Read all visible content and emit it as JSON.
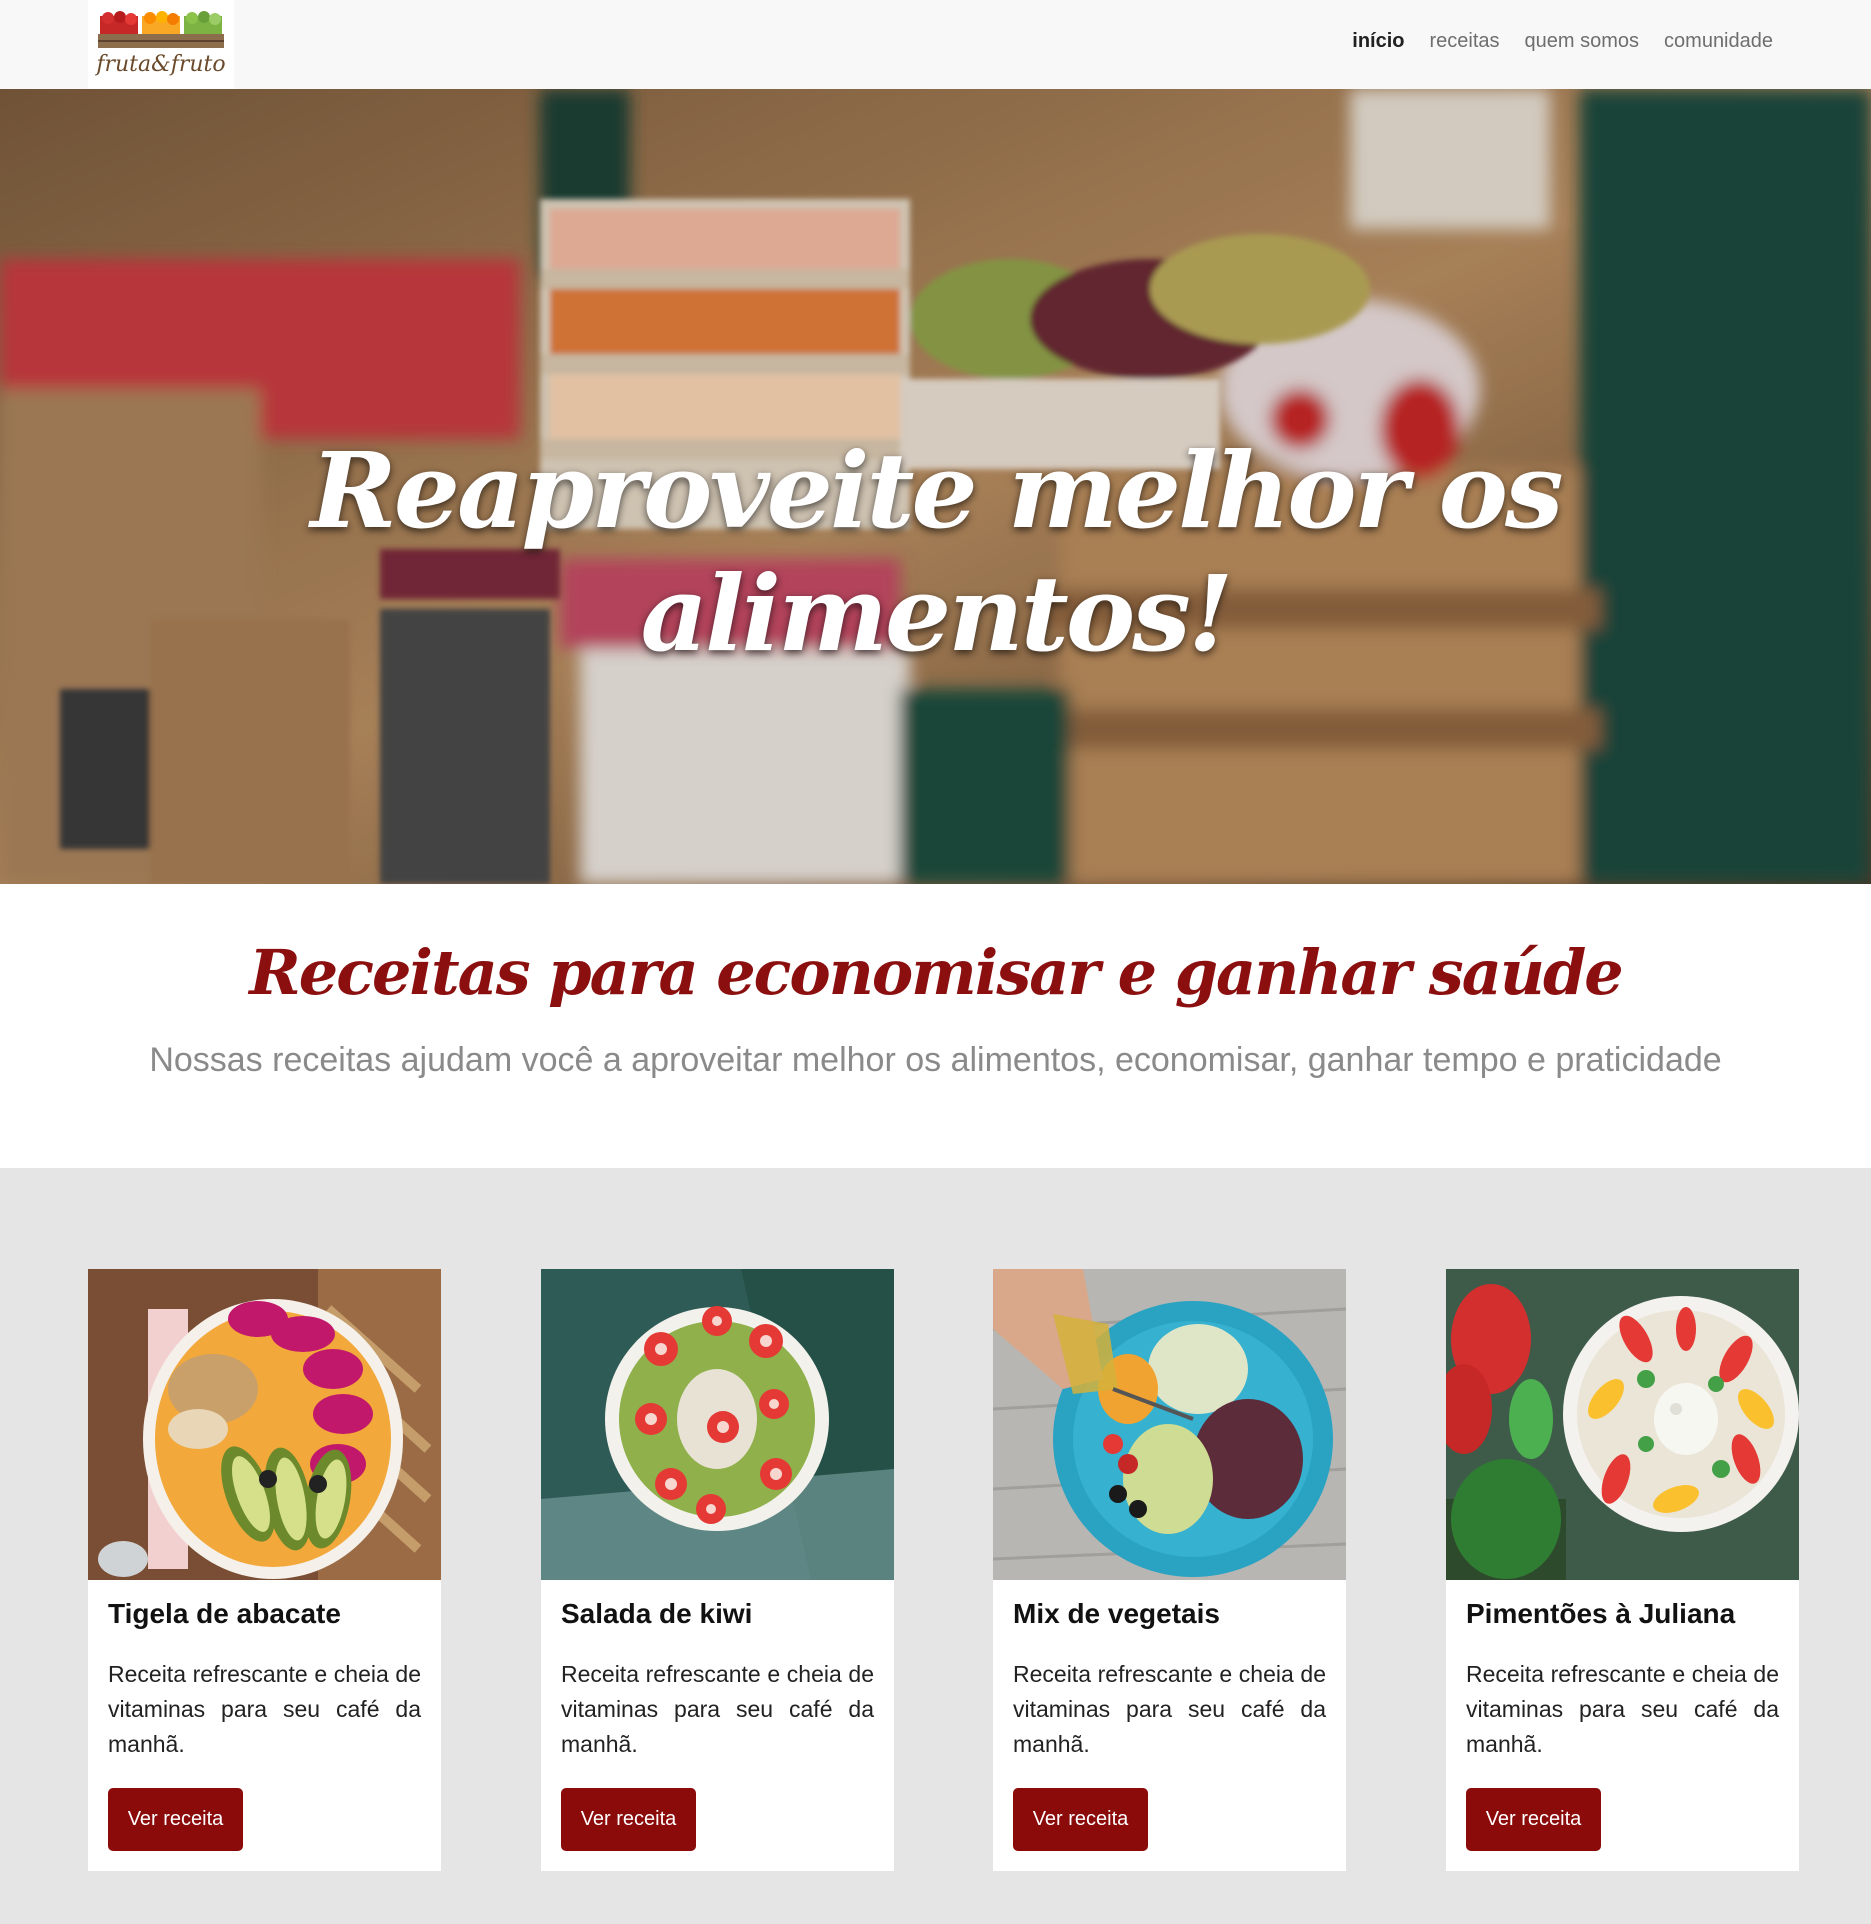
{
  "logo": {
    "text": "fruta&fruto"
  },
  "nav": [
    {
      "label": "início",
      "active": true
    },
    {
      "label": "receitas",
      "active": false
    },
    {
      "label": "quem somos",
      "active": false
    },
    {
      "label": "comunidade",
      "active": false
    }
  ],
  "hero": {
    "title": "Reaproveite melhor os alimentos!"
  },
  "intro": {
    "title": "Receitas para economisar e ganhar saúde",
    "subtitle": "Nossas receitas ajudam você a aproveitar melhor os alimentos, economisar, ganhar tempo e praticidade"
  },
  "recipes": [
    {
      "title": "Tigela de abacate",
      "description": "Receita refrescante e cheia de vitaminas para seu café da manhã.",
      "button": "Ver receita"
    },
    {
      "title": "Salada de kiwi",
      "description": "Receita refrescante e cheia de vitaminas para seu café da manhã.",
      "button": "Ver receita"
    },
    {
      "title": "Mix de vegetais",
      "description": "Receita refrescante e cheia de vitaminas para seu café da manhã.",
      "button": "Ver receita"
    },
    {
      "title": "Pimentões à Juliana",
      "description": "Receita refrescante e cheia de vitaminas para seu café da manhã.",
      "button": "Ver receita"
    }
  ],
  "colors": {
    "brand_red": "#8b0a0a",
    "navbar_bg": "#f8f8f8",
    "section_bg": "#e5e5e5"
  }
}
